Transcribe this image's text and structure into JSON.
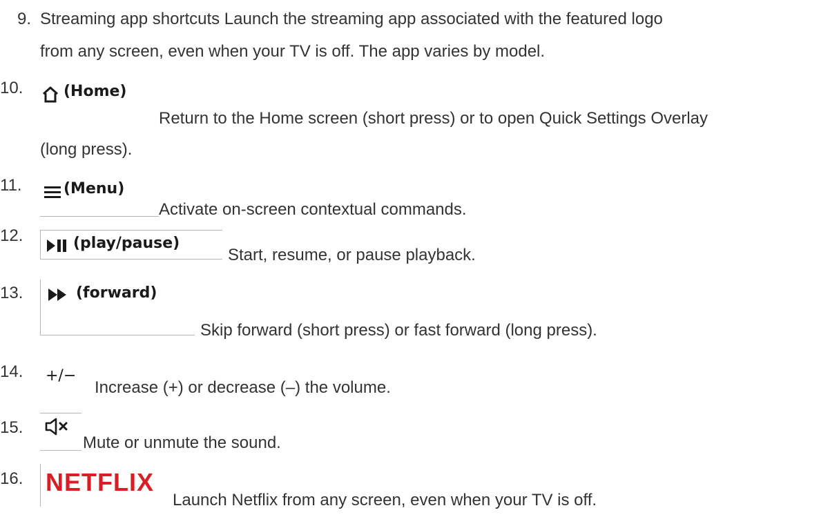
{
  "items": [
    {
      "number": "9.",
      "title": "Streaming app shortcuts",
      "line1": "Streaming app shortcuts Launch the streaming app associated with the featured logo",
      "line2": "from any screen, even when your TV is off. The app varies by model."
    },
    {
      "number": "10.",
      "button_label": "(Home)",
      "icon": "home-icon",
      "line1": "Return to the Home screen (short press) or to open Quick Settings Overlay",
      "line2": "(long press)."
    },
    {
      "number": "11.",
      "button_label": "(Menu)",
      "icon": "menu-icon",
      "line1": "Activate on-screen contextual commands."
    },
    {
      "number": "12.",
      "button_label": "(play/pause)",
      "icon": "play-pause-icon",
      "line1": "Start, resume, or pause playback."
    },
    {
      "number": "13.",
      "button_label": "(forward)",
      "icon": "fast-forward-icon",
      "line1": "Skip forward (short press) or fast forward (long press)."
    },
    {
      "number": "14.",
      "button_label": "+/−",
      "icon": "volume-icon",
      "line1": "Increase (+) or decrease (–) the volume."
    },
    {
      "number": "15.",
      "icon": "mute-icon",
      "line1": "Mute or unmute the sound."
    },
    {
      "number": "16.",
      "logo_text": "NETFLIX",
      "icon": "netflix-logo",
      "line1": "Launch Netflix from any screen, even when your TV is off."
    }
  ]
}
